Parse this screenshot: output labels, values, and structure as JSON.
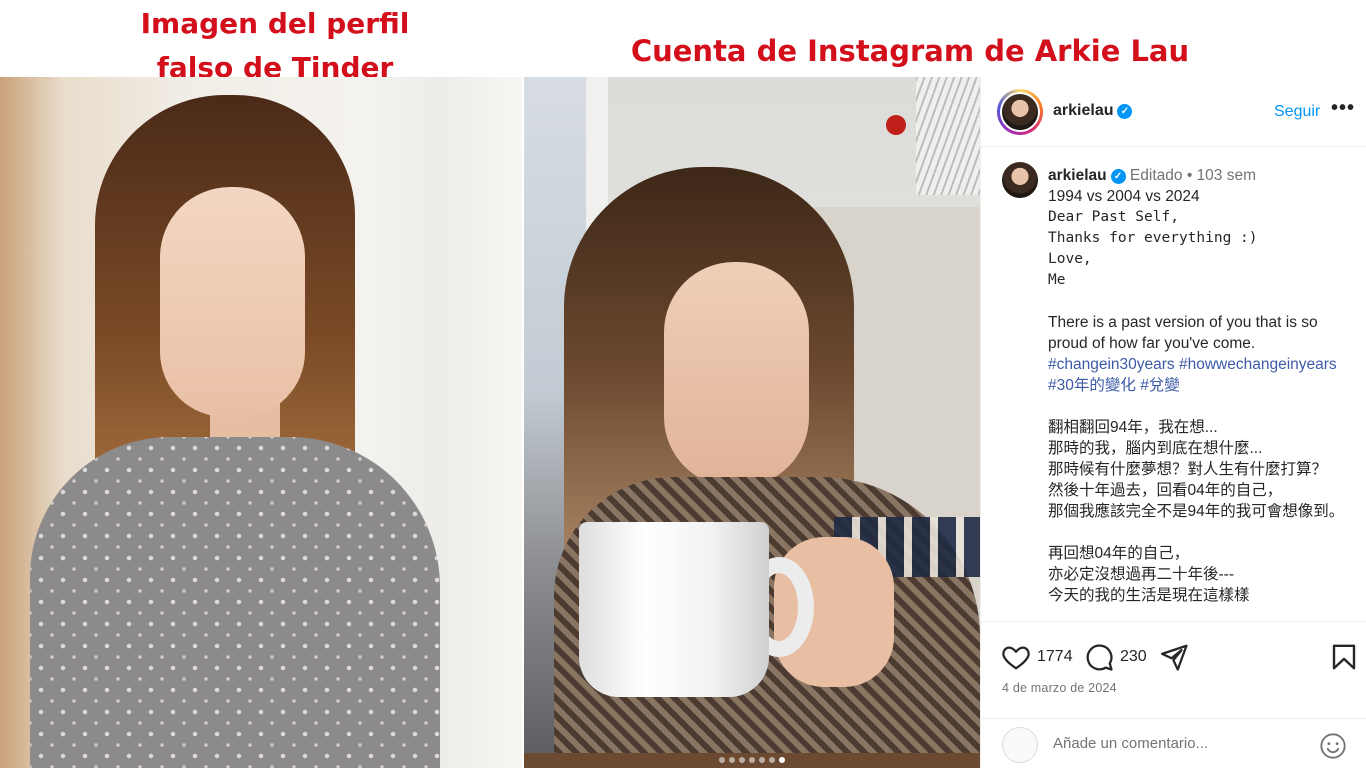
{
  "captions": {
    "left_line1": "Imagen del perfil",
    "left_line2": "falso de Tinder",
    "right": "Cuenta de Instagram de Arkie Lau"
  },
  "post_header": {
    "username": "arkielau",
    "verified": true,
    "follow_label": "Seguir",
    "more_label": "•••"
  },
  "caption": {
    "username": "arkielau",
    "edited_label": "Editado",
    "separator": "•",
    "age": "103 sem",
    "lines": [
      "1994 vs 2004 vs 2024"
    ],
    "mono_lines": [
      "Dear Past Self,",
      "Thanks for everything :)",
      "Love,",
      "Me"
    ],
    "paragraph": "There is a past version of you that is so proud of how far you've come.",
    "hashtags": [
      "#changein30years",
      "#howwechangeinyears",
      "#30年的變化",
      "#兌變"
    ],
    "zh_lines_1": [
      "翻相翻回94年，我在想...",
      "那時的我，腦内到底在想什麼...",
      "那時候有什麼夢想？對人生有什麼打算？",
      "然後十年過去，回看04年的自己，",
      "那個我應該完全不是94年的我可會想像到。"
    ],
    "zh_lines_2": [
      "再回想04年的自己，",
      "亦必定沒想過再二十年後---",
      "今天的我的生活是現在這樣樣"
    ]
  },
  "actions": {
    "likes": "1774",
    "comments": "230",
    "date": "4 de marzo de 2024"
  },
  "comment_box": {
    "placeholder": "Añade un comentario..."
  },
  "carousel": {
    "count": 7,
    "active_index": 6
  },
  "colors": {
    "caption_red": "#d20f1b",
    "ig_blue": "#0095f6",
    "hashtag": "#3d5aa8"
  }
}
